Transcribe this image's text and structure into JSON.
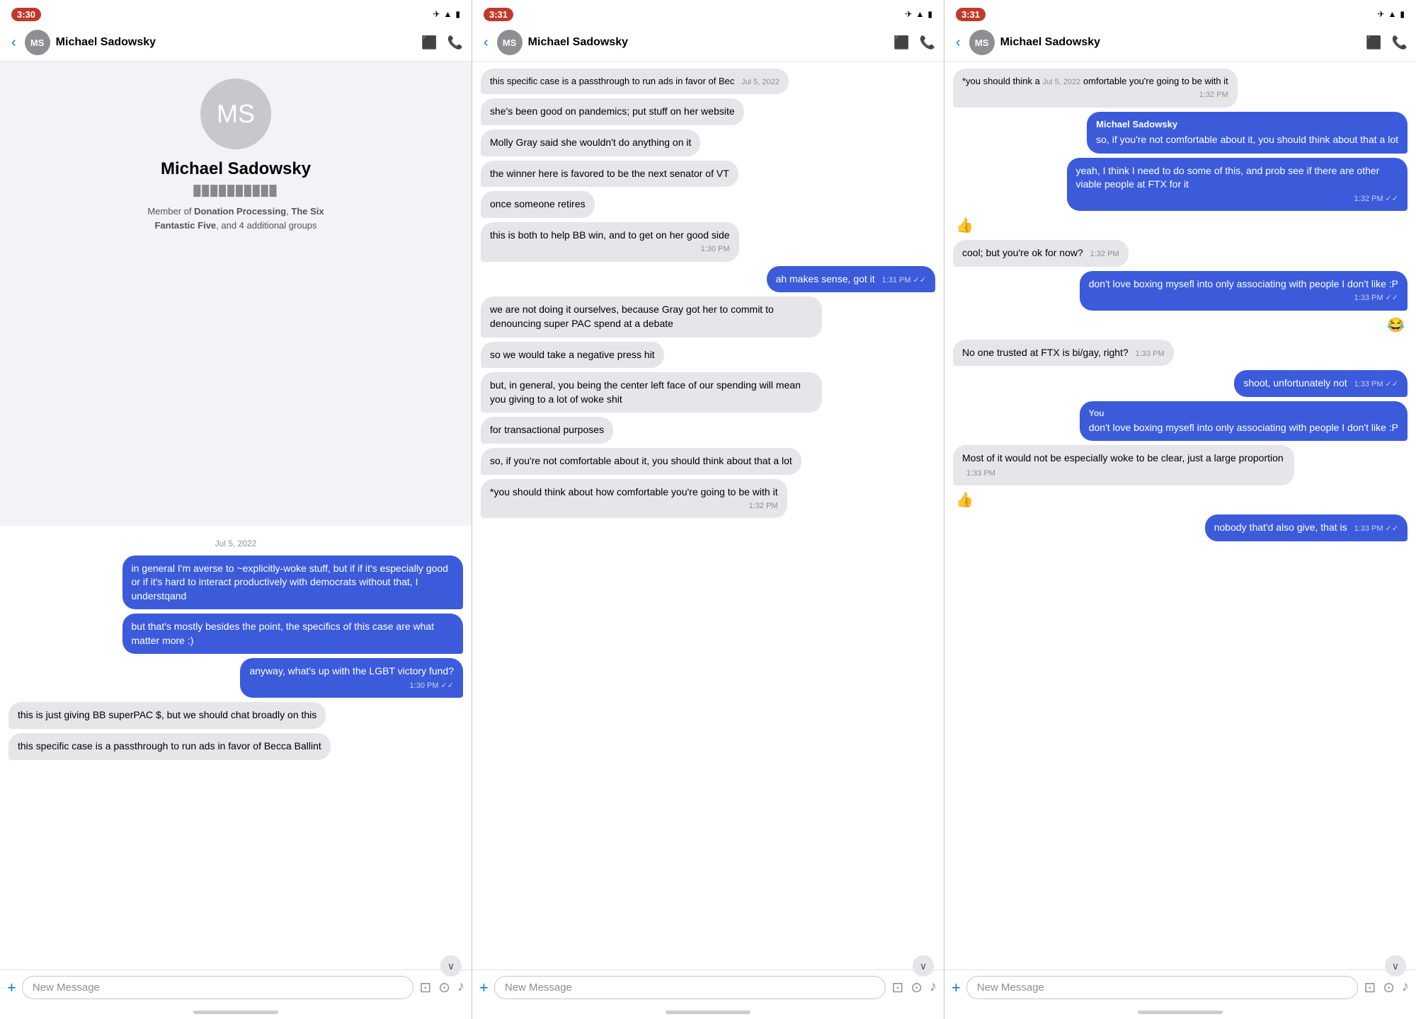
{
  "screens": [
    {
      "id": "screen1",
      "statusBar": {
        "time": "3:30",
        "icons": "✈ ▾ ▮"
      },
      "header": {
        "back": "‹",
        "avatarInitials": "MS",
        "name": "Michael Sadowsky",
        "videoIcon": "📷",
        "phoneIcon": "📞"
      },
      "profile": {
        "initials": "MS",
        "name": "Michael Sadowsky",
        "phone": "████ ████ ████",
        "groups": "Member of Donation Processing, The Six Fantastic Five, and 4 additional groups"
      },
      "dateLabel": "Jul 5, 2022",
      "messages": [
        {
          "type": "sent",
          "text": "in general I'm averse to ~explicitly-woke stuff, but if if it's especially good or if it's hard to interact productively with democrats without that, I understqand",
          "time": ""
        },
        {
          "type": "sent",
          "text": "but that's mostly besides the point, the specifics of this case are what matter more :)",
          "time": ""
        },
        {
          "type": "sent",
          "text": "anyway, what's up with the LGBT victory fund?",
          "time": "1:30 PM",
          "checkmark": true
        },
        {
          "type": "received",
          "text": "this is just giving BB superPAC $, but we should chat broadly on this",
          "time": ""
        },
        {
          "type": "received",
          "text": "this specific case is a passthrough to run ads in favor of Becca Ballint",
          "time": ""
        }
      ],
      "inputPlaceholder": "New Message"
    },
    {
      "id": "screen2",
      "statusBar": {
        "time": "3:31",
        "icons": "✈ ▾ ▮"
      },
      "header": {
        "back": "‹",
        "avatarInitials": "MS",
        "name": "Michael Sadowsky",
        "videoIcon": "📷",
        "phoneIcon": "📞"
      },
      "messages": [
        {
          "type": "received",
          "text": "this specific case is a passthrough to run ads in favor of Bec",
          "dateTag": "Jul 5, 2022",
          "time": ""
        },
        {
          "type": "received",
          "text": "she's been good on pandemics; put stuff on her website",
          "time": ""
        },
        {
          "type": "received",
          "text": "Molly Gray said she wouldn't do anything on it",
          "time": ""
        },
        {
          "type": "received",
          "text": "the winner here is favored to be the next senator of VT",
          "time": ""
        },
        {
          "type": "received",
          "text": "once someone retires",
          "time": ""
        },
        {
          "type": "received",
          "text": "this is both to help BB win, and to get on her good side",
          "time": "1:30 PM"
        },
        {
          "type": "sent",
          "text": "ah makes sense, got it",
          "time": "1:31 PM",
          "checkmark": true
        },
        {
          "type": "received",
          "text": "we are not doing it ourselves, because Gray got her to commit to denouncing super PAC spend at a debate",
          "time": ""
        },
        {
          "type": "received",
          "text": "so we would take a negative press hit",
          "time": ""
        },
        {
          "type": "received",
          "text": "but, in general, you being the center left face of our spending will mean you giving to a lot of woke shit",
          "time": ""
        },
        {
          "type": "received",
          "text": "for transactional purposes",
          "time": ""
        },
        {
          "type": "received",
          "text": "so, if you're not comfortable about it, you should think about that a lot",
          "time": ""
        },
        {
          "type": "received",
          "text": "*you should think about how comfortable you're going to be with it",
          "time": "1:32 PM"
        }
      ],
      "inputPlaceholder": "New Message"
    },
    {
      "id": "screen3",
      "statusBar": {
        "time": "3:31",
        "icons": "✈ ▾ ▮"
      },
      "header": {
        "back": "‹",
        "avatarInitials": "MS",
        "name": "Michael Sadowsky",
        "videoIcon": "📷",
        "phoneIcon": "📞"
      },
      "messages": [
        {
          "type": "received",
          "text": "*you should think a",
          "dateTag": "Jul 5, 2022",
          "cutoff": "omfortable you're going to be with it",
          "time": "1:32 PM",
          "combined": "*you should think a  Jul 5, 2022  omfortable you're going to be with it"
        },
        {
          "type": "sent-named",
          "sender": "Michael Sadowsky",
          "text": "so, if you're not comfortable about it, you should think about that a lot",
          "time": ""
        },
        {
          "type": "sent",
          "text": "yeah, I think I need to do some of this, and prob see if there are other viable people at FTX for it",
          "time": "1:32 PM",
          "checkmark": true
        },
        {
          "type": "emoji",
          "text": "👍",
          "align": "received"
        },
        {
          "type": "received",
          "text": "cool; but you're ok for now?",
          "time": "1:32 PM"
        },
        {
          "type": "sent",
          "text": "don't love boxing mysefl into only associating with people I don't like :P",
          "time": "1:33 PM",
          "checkmark": true
        },
        {
          "type": "emoji",
          "text": "😂",
          "align": "sent"
        },
        {
          "type": "received",
          "text": "No one trusted at FTX is bi/gay, right?",
          "time": "1:33 PM"
        },
        {
          "type": "sent",
          "text": "shoot, unfortunately not",
          "time": "1:33 PM",
          "checkmark": true
        },
        {
          "type": "you-named",
          "sender": "You",
          "text": "don't love boxing mysefl into only associating with people I don't like :P",
          "time": ""
        },
        {
          "type": "received",
          "text": "Most of it would not be especially woke to be clear, just a large proportion",
          "time": "1:33 PM"
        },
        {
          "type": "emoji",
          "text": "👍",
          "align": "received"
        },
        {
          "type": "sent",
          "text": "nobody that'd also give, that is",
          "time": "1:33 PM",
          "checkmark": true
        }
      ],
      "inputPlaceholder": "New Message"
    }
  ]
}
